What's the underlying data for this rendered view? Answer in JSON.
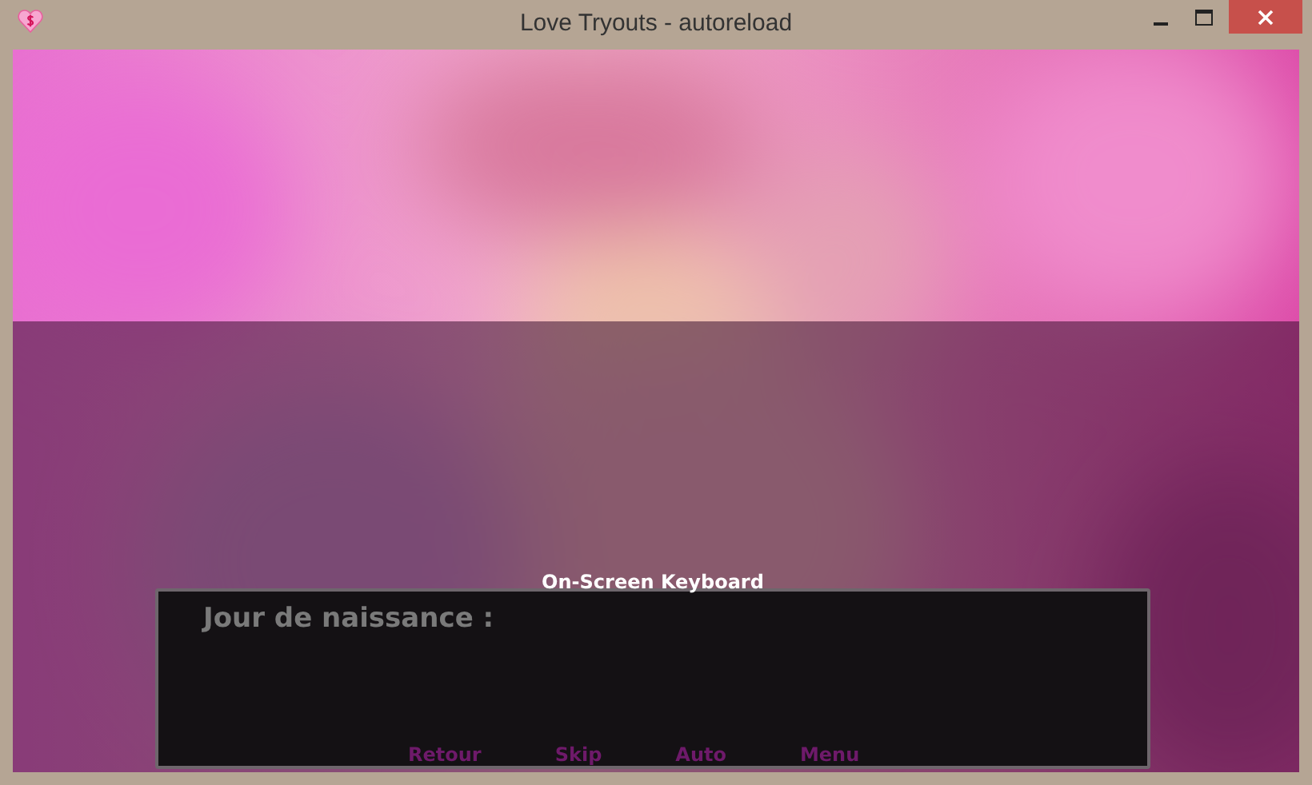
{
  "window": {
    "title": "Love Tryouts - autoreload"
  },
  "keyboard_label": "On-Screen Keyboard",
  "dialogue": {
    "speaker": "Jour de naissance :"
  },
  "quick_menu": [
    {
      "label": "Retour"
    },
    {
      "label": "Skip"
    },
    {
      "label": "Auto"
    },
    {
      "label": "Menu"
    }
  ]
}
